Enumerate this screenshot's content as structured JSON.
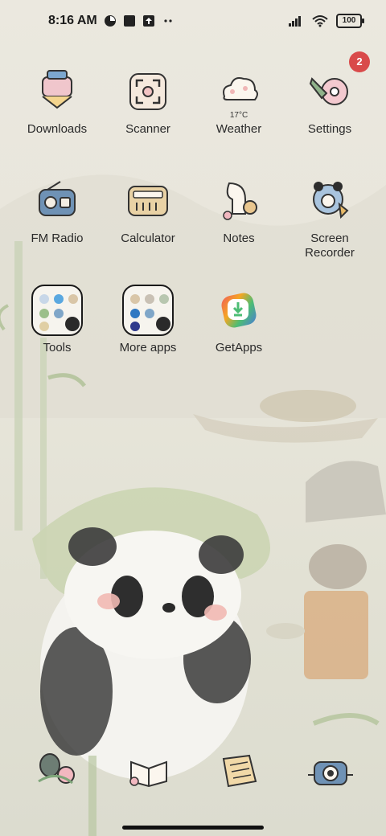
{
  "status_bar": {
    "time": "8:16 AM",
    "battery": "100",
    "icons": [
      "notification-icon",
      "app-icon",
      "upload-icon",
      "more-dots-icon",
      "signal-icon",
      "wifi-icon",
      "battery-icon"
    ]
  },
  "apps": [
    {
      "label": "Downloads",
      "icon": "downloads-icon"
    },
    {
      "label": "Scanner",
      "icon": "scanner-icon"
    },
    {
      "label": "Weather",
      "icon": "weather-icon",
      "temp": "17°C"
    },
    {
      "label": "Settings",
      "icon": "settings-icon",
      "badge": "2"
    },
    {
      "label": "FM Radio",
      "icon": "radio-icon"
    },
    {
      "label": "Calculator",
      "icon": "calculator-icon"
    },
    {
      "label": "Notes",
      "icon": "notes-icon"
    },
    {
      "label": "Screen\nRecorder",
      "icon": "screen-recorder-icon"
    },
    {
      "label": "Tools",
      "icon": "folder-icon"
    },
    {
      "label": "More apps",
      "icon": "folder-icon"
    },
    {
      "label": "GetApps",
      "icon": "getapps-icon"
    }
  ],
  "dock": [
    {
      "icon": "phone-icon"
    },
    {
      "icon": "messages-icon"
    },
    {
      "icon": "browser-icon"
    },
    {
      "icon": "camera-icon"
    }
  ],
  "colors": {
    "badge": "#d94a4a",
    "wallpaper": "#e7e5da"
  }
}
